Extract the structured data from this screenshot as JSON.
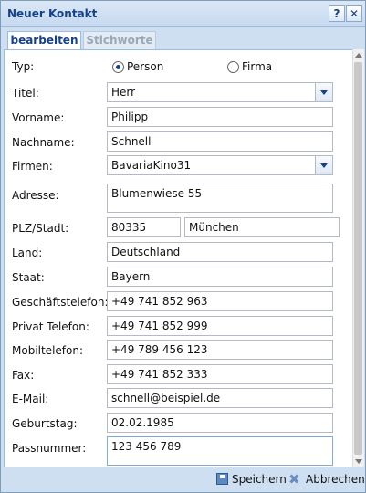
{
  "window": {
    "title": "Neuer Kontakt",
    "help_glyph": "?",
    "close_glyph": "✕"
  },
  "tabs": [
    {
      "label": "bearbeiten"
    },
    {
      "label": "Stichworte"
    }
  ],
  "form": {
    "typ": {
      "label": "Typ:",
      "options": [
        {
          "label": "Person",
          "selected": true
        },
        {
          "label": "Firma",
          "selected": false
        }
      ]
    },
    "titel": {
      "label": "Titel:",
      "value": "Herr"
    },
    "vorname": {
      "label": "Vorname:",
      "value": "Philipp"
    },
    "nachname": {
      "label": "Nachname:",
      "value": "Schnell"
    },
    "firmen": {
      "label": "Firmen:",
      "value": "BavariaKino31"
    },
    "adresse": {
      "label": "Adresse:",
      "value": "Blumenwiese 55"
    },
    "plz_stadt": {
      "label": "PLZ/Stadt:",
      "plz": "80335",
      "stadt": "München"
    },
    "land": {
      "label": "Land:",
      "value": "Deutschland"
    },
    "staat": {
      "label": "Staat:",
      "value": "Bayern"
    },
    "geschaeftstelefon": {
      "label": "Geschäftstelefon:",
      "value": "+49 741 852 963"
    },
    "privat_telefon": {
      "label": "Privat Telefon:",
      "value": "+49 741 852 999"
    },
    "mobiltelefon": {
      "label": "Mobiltelefon:",
      "value": "+49 789 456 123"
    },
    "fax": {
      "label": "Fax:",
      "value": "+49 741 852 333"
    },
    "email": {
      "label": "E-Mail:",
      "value": "schnell@beispiel.de"
    },
    "geburtstag": {
      "label": "Geburtstag:",
      "value": "02.02.1985"
    },
    "passnummer": {
      "label": "Passnummer:",
      "value": "123 456 789"
    }
  },
  "footer": {
    "save_label": "Speichern",
    "cancel_label": "Abbrechen"
  },
  "colors": {
    "accent": "#15428b",
    "window_bg": "#cfdff2",
    "border": "#99bbe8"
  }
}
